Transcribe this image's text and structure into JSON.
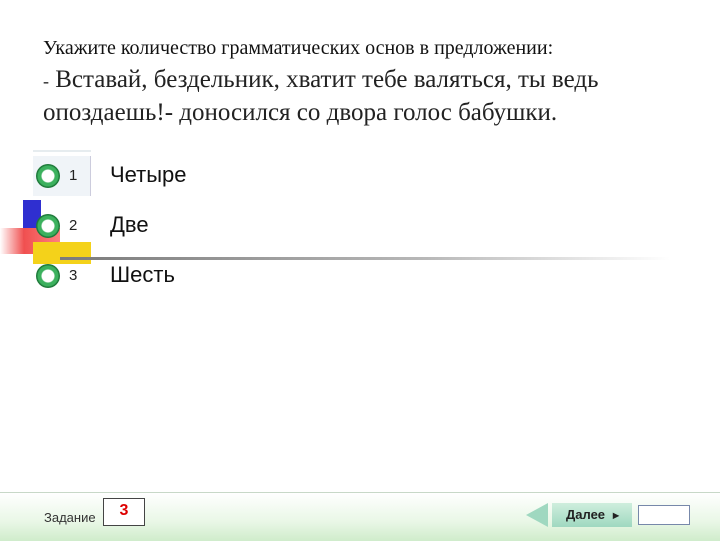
{
  "question": "Укажите количество грамматических основ в предложении:",
  "sentence": {
    "dash": "-",
    "text": "Вставай, бездельник, хватит тебе валяться, ты ведь опоздаешь!- доносился со двора голос бабушки."
  },
  "options": [
    {
      "number": "1",
      "label": "Четыре"
    },
    {
      "number": "2",
      "label": "Две"
    },
    {
      "number": "3",
      "label": "Шесть"
    }
  ],
  "footer": {
    "task_label": "Задание",
    "task_number": "3",
    "next_label": "Далее",
    "next_arrow": "►"
  },
  "colors": {
    "radio": "#3cb15e",
    "task_number": "#dd0000",
    "nav": "#9fd8c0"
  }
}
